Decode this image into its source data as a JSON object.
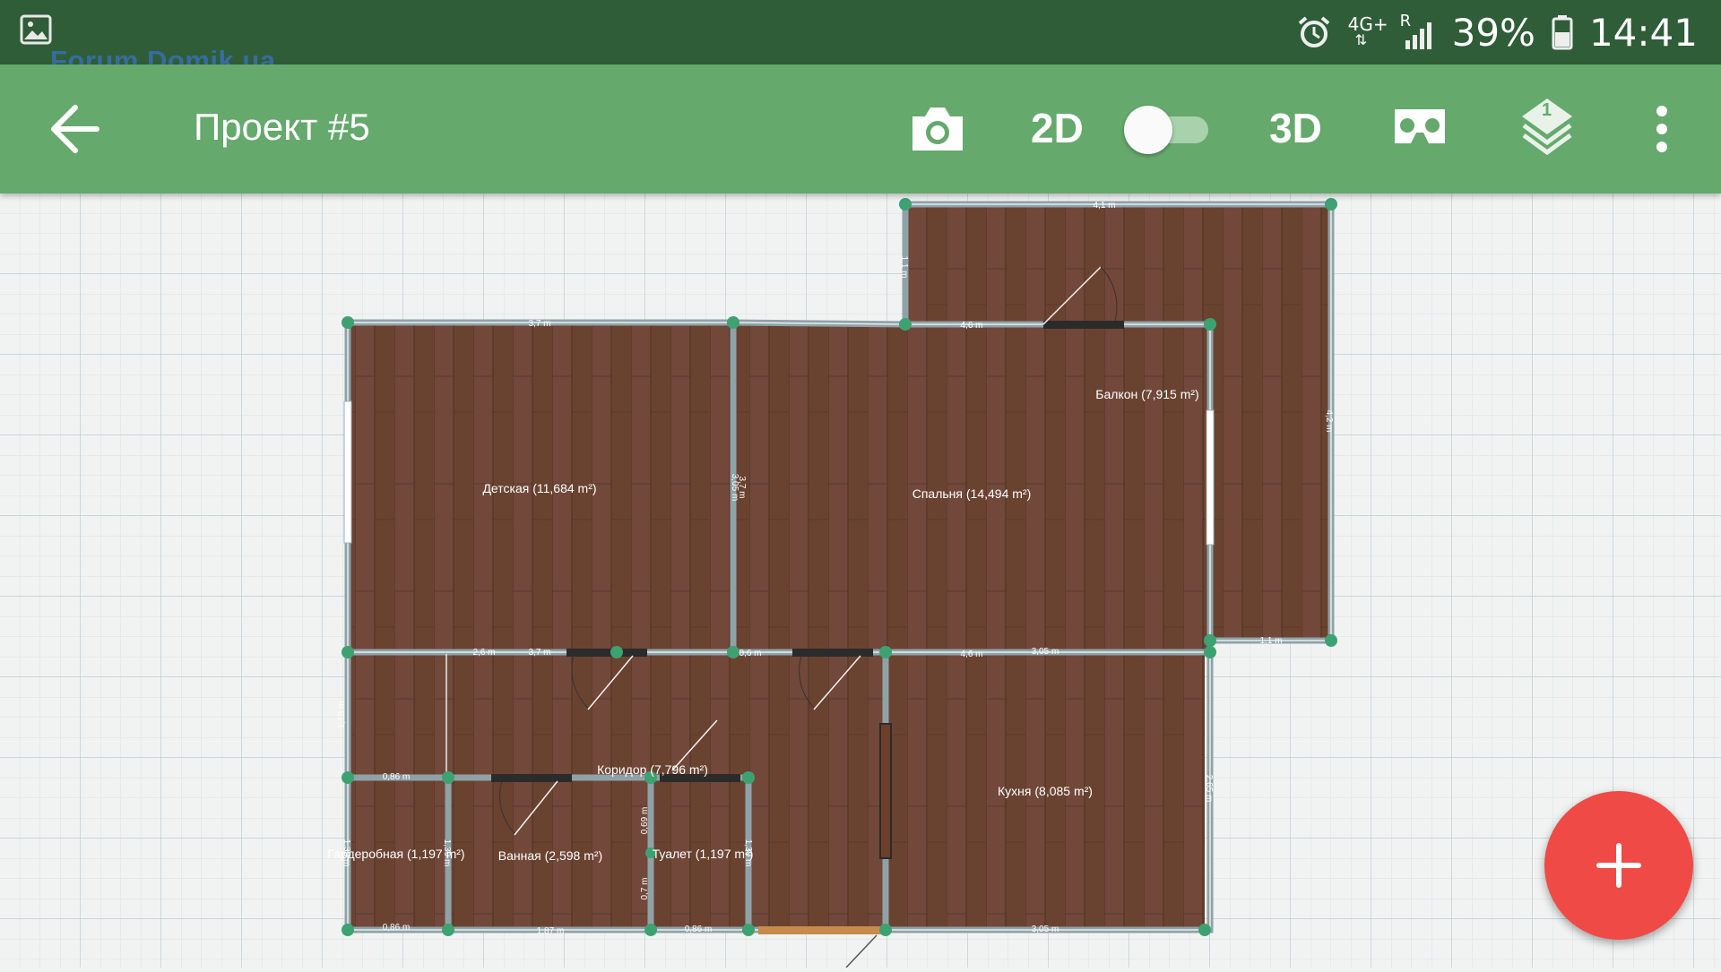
{
  "status_bar": {
    "network": "4G+",
    "roaming": "R",
    "battery": "39%",
    "time": "14:41",
    "icons": [
      "gallery-icon",
      "alarm-icon",
      "signal-icon",
      "battery-icon"
    ]
  },
  "watermark": {
    "text": "Forum.Domik.ua"
  },
  "toolbar": {
    "title": "Проект #5",
    "mode_2d": "2D",
    "mode_3d": "3D",
    "view_toggle_state": "2D",
    "layers_badge": "1",
    "icons": [
      "back-arrow-icon",
      "camera-icon",
      "vr-headset-icon",
      "layers-icon",
      "more-vert-icon"
    ]
  },
  "plan": {
    "rooms": [
      {
        "label": "Детская (11,684 m²)"
      },
      {
        "label": "Спальня (14,494 m²)"
      },
      {
        "label": "Балкон (7,915 m²)"
      },
      {
        "label": "Коридор (7,796 m²)"
      },
      {
        "label": "Кухня (8,085 m²)"
      },
      {
        "label": "Ванная (2,598 m²)"
      },
      {
        "label": "Туалет (1,197 m²)"
      },
      {
        "label": "Гардеробная (1,197 m²)"
      }
    ],
    "dimensions": [
      "4,1 m",
      "1,1 m",
      "3,7 m",
      "4,6 m",
      "4,2 m",
      "3,05 m",
      "3,7 m",
      "1,1 m",
      "2,6 m",
      "3,7 m",
      "0,6 m",
      "4,6 m",
      "3,05 m",
      "1,13 m",
      "0,86 m",
      "2,65 m",
      "1,39 m",
      "1,39 m",
      "0,69 m",
      "1,39 m",
      "0,86 m",
      "1,87 m",
      "0,86 m",
      "3,05 m",
      "0,7 m"
    ]
  },
  "fab": {
    "symbol": "+",
    "icon": "add-icon"
  },
  "colors": {
    "status_bar": "#2f5d38",
    "toolbar": "#65a96c",
    "fab": "#ef4a45",
    "floor": "#6a4330",
    "wall": "#8fa2a8",
    "grid": "#c9d6dd"
  }
}
